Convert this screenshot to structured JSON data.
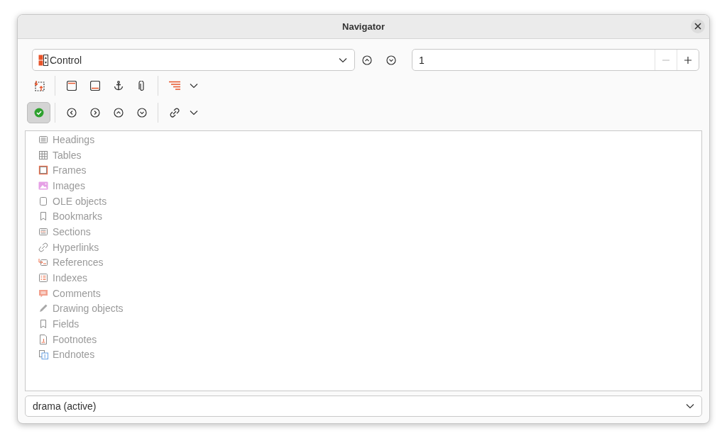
{
  "window": {
    "title": "Navigator"
  },
  "navigate_by": {
    "value": "Control"
  },
  "page": {
    "value": "1",
    "decrement_disabled": true,
    "increment_disabled": false
  },
  "toolbar_rows": [
    [
      {
        "kind": "drag",
        "pressed": false
      },
      {
        "kind": "sep"
      },
      {
        "kind": "header",
        "pressed": false
      },
      {
        "kind": "footer",
        "pressed": false
      },
      {
        "kind": "anchor",
        "pressed": false
      },
      {
        "kind": "clip",
        "pressed": false
      },
      {
        "kind": "sep"
      },
      {
        "kind": "levels",
        "pressed": false
      },
      {
        "kind": "caret"
      }
    ],
    [
      {
        "kind": "check",
        "pressed": true
      },
      {
        "kind": "sep"
      },
      {
        "kind": "left",
        "pressed": false
      },
      {
        "kind": "right",
        "pressed": false
      },
      {
        "kind": "up",
        "pressed": false
      },
      {
        "kind": "down",
        "pressed": false
      },
      {
        "kind": "sep"
      },
      {
        "kind": "link",
        "pressed": false
      },
      {
        "kind": "caret"
      }
    ]
  ],
  "items": [
    {
      "label": "Headings",
      "kind": "headings",
      "disabled": true
    },
    {
      "label": "Tables",
      "kind": "tables",
      "disabled": true
    },
    {
      "label": "Frames",
      "kind": "frames",
      "disabled": true
    },
    {
      "label": "Images",
      "kind": "images",
      "disabled": true
    },
    {
      "label": "OLE objects",
      "kind": "ole",
      "disabled": true
    },
    {
      "label": "Bookmarks",
      "kind": "bookmarks",
      "disabled": true
    },
    {
      "label": "Sections",
      "kind": "sections",
      "disabled": true
    },
    {
      "label": "Hyperlinks",
      "kind": "hyperlinks",
      "disabled": true
    },
    {
      "label": "References",
      "kind": "references",
      "disabled": true
    },
    {
      "label": "Indexes",
      "kind": "indexes",
      "disabled": true
    },
    {
      "label": "Comments",
      "kind": "comments",
      "disabled": true
    },
    {
      "label": "Drawing objects",
      "kind": "drawing",
      "disabled": true
    },
    {
      "label": "Fields",
      "kind": "fields",
      "disabled": true
    },
    {
      "label": "Footnotes",
      "kind": "footnotes",
      "disabled": true
    },
    {
      "label": "Endnotes",
      "kind": "endnotes",
      "disabled": true
    }
  ],
  "document": {
    "value": "drama (active)"
  }
}
